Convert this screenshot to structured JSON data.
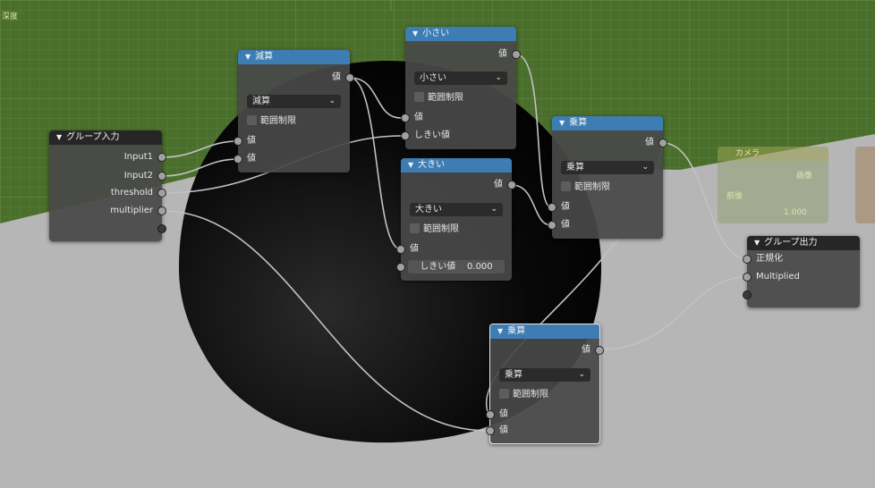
{
  "colors": {
    "grid_bg": "#4a6e2c",
    "node_bg": "#484848",
    "header_math": "#3d7db3",
    "header_group": "#262626",
    "wire": "#c2c2c2"
  },
  "background": {
    "top_left_label": "深度",
    "camera_node_title": "カメラ",
    "camera_out_label": "画像",
    "camera_in_label": "前後",
    "camera_value": "1.000"
  },
  "nodes": {
    "group_input": {
      "title": "グループ入力",
      "outputs": [
        "Input1",
        "Input2",
        "threshold",
        "multiplier"
      ]
    },
    "subtract": {
      "title": "減算",
      "output": "値",
      "operation": "減算",
      "clamp_label": "範囲制限",
      "inputs": [
        "値",
        "値"
      ]
    },
    "less_than": {
      "title": "小さい",
      "output": "値",
      "operation": "小さい",
      "clamp_label": "範囲制限",
      "inputs": [
        "値",
        "しきい値"
      ]
    },
    "greater_than": {
      "title": "大きい",
      "output": "値",
      "operation": "大きい",
      "clamp_label": "範囲制限",
      "input_value": "値",
      "threshold_label": "しきい値",
      "threshold_value": "0.000"
    },
    "multiply_top": {
      "title": "乗算",
      "output": "値",
      "operation": "乗算",
      "clamp_label": "範囲制限",
      "inputs": [
        "値",
        "値"
      ]
    },
    "multiply_bottom": {
      "title": "乗算",
      "output": "値",
      "operation": "乗算",
      "clamp_label": "範囲制限",
      "inputs": [
        "値",
        "値"
      ]
    },
    "group_output": {
      "title": "グループ出力",
      "inputs": [
        "正規化",
        "Multiplied"
      ]
    }
  }
}
